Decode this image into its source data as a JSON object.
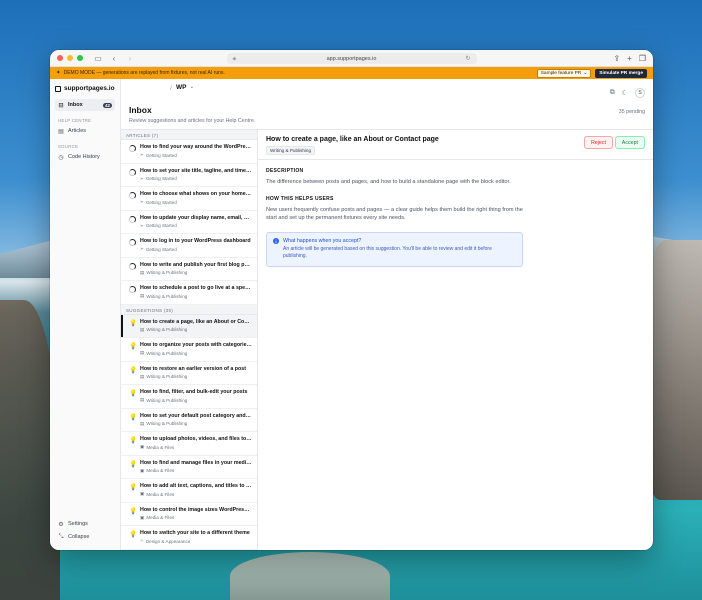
{
  "browser": {
    "url": "app.supportpages.io"
  },
  "banner": {
    "text": "DEMO MODE — generations are replayed from fixtures, not real AI runs.",
    "sample_label": "Sample feature PR",
    "simulate_label": "Simulate PR merge"
  },
  "brand": {
    "name": "supportpages.io",
    "workspace": "WP"
  },
  "user": {
    "initial": "S"
  },
  "sidebar": {
    "inbox_label": "Inbox",
    "inbox_count": "42",
    "help_centre_label": "HELP CENTRE",
    "articles_label": "Articles",
    "source_label": "SOURCE",
    "code_history_label": "Code History",
    "settings_label": "Settings",
    "collapse_label": "Collapse"
  },
  "page": {
    "title": "Inbox",
    "subtitle": "Review suggestions and articles for your Help Centre.",
    "pending": "35 pending"
  },
  "articles_header": "ARTICLES (7)",
  "articles": [
    {
      "title": "How to find your way around the WordPress ...",
      "category": "Getting Started"
    },
    {
      "title": "How to set your site title, tagline, and timezone",
      "category": "Getting Started"
    },
    {
      "title": "How to choose what shows on your homepage",
      "category": "Getting Started"
    },
    {
      "title": "How to update your display name, email, and...",
      "category": "Getting Started"
    },
    {
      "title": "How to log in to your WordPress dashboard",
      "category": "Getting Started"
    },
    {
      "title": "How to write and publish your first blog post",
      "category": "Writing & Publishing"
    },
    {
      "title": "How to schedule a post to go live at a specifi...",
      "category": "Writing & Publishing"
    }
  ],
  "suggestions_header": "SUGGESTIONS (35)",
  "suggestions": [
    {
      "title": "How to create a page, like an About or Conta...",
      "category": "Writing & Publishing"
    },
    {
      "title": "How to organize your posts with categories a...",
      "category": "Writing & Publishing"
    },
    {
      "title": "How to restore an earlier version of a post",
      "category": "Writing & Publishing"
    },
    {
      "title": "How to find, filter, and bulk-edit your posts",
      "category": "Writing & Publishing"
    },
    {
      "title": "How to set your default post category and wr...",
      "category": "Writing & Publishing"
    },
    {
      "title": "How to upload photos, videos, and files to yo...",
      "category": "Media & Files"
    },
    {
      "title": "How to find and manage files in your media li...",
      "category": "Media & Files"
    },
    {
      "title": "How to add alt text, captions, and titles to yo...",
      "category": "Media & Files"
    },
    {
      "title": "How to control the image sizes WordPress g...",
      "category": "Media & Files"
    },
    {
      "title": "How to switch your site to a different theme",
      "category": "Design & Appearance"
    }
  ],
  "detail": {
    "title": "How to create a page, like an About or Contact page",
    "category": "Writing & Publishing",
    "reject_label": "Reject",
    "accept_label": "Accept",
    "description_heading": "DESCRIPTION",
    "description": "The difference between posts and pages, and how to build a standalone page with the block editor.",
    "helps_heading": "HOW THIS HELPS USERS",
    "helps": "New users frequently confuse posts and pages — a clear guide helps them build the right thing from the start and set up the permanent fixtures every site needs.",
    "info_title": "What happens when you accept?",
    "info_body": "An article will be generated based on this suggestion. You'll be able to review and edit it before publishing."
  },
  "colors": {
    "banner": "#f59e0b",
    "accent_accept": "#15803d",
    "accent_reject": "#dc2626",
    "info_blue": "#2563eb",
    "suggestion_icon": "#ea7a2e"
  }
}
